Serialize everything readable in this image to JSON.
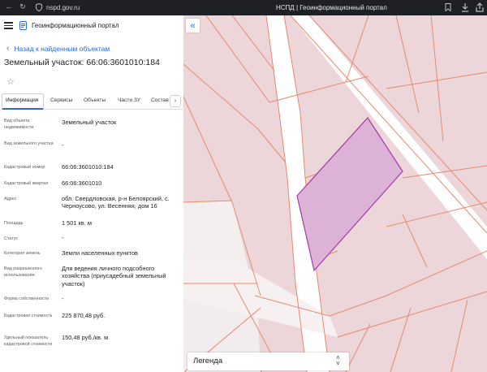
{
  "browser": {
    "url": "nspd.gov.ru",
    "tab_title": "НСПД | Геоинформационный портал"
  },
  "header": {
    "portal_title": "Геоинформационный портал"
  },
  "nav": {
    "back_label": "Назад к найденным объектам"
  },
  "parcel": {
    "title": "Земельный участок: 66:06:3601010:184"
  },
  "tabs": [
    {
      "label": "Информация",
      "active": true
    },
    {
      "label": "Сервисы"
    },
    {
      "label": "Объекты"
    },
    {
      "label": "Части ЗУ"
    },
    {
      "label": "Состав"
    }
  ],
  "attributes": [
    {
      "label": "Вид объекта недвижимости",
      "value": "Земельный участок"
    },
    {
      "label": "Вид земельного участка",
      "value": "-"
    },
    {
      "label": "Кадастровый номер",
      "value": "66:06:3601010:184"
    },
    {
      "label": "Кадастровый квартал",
      "value": "66:06:3601010"
    },
    {
      "label": "Адрес",
      "value": "обл. Свердловская, р-н Белоярский, с. Черноусово, ул. Весенняя, дом 16"
    },
    {
      "label": "Площадь",
      "value": "1 501 кв. м"
    },
    {
      "label": "Статус",
      "value": "-"
    },
    {
      "label": "Категория земель",
      "value": "Земли населенных пунктов"
    },
    {
      "label": "Вид разрешенного использования",
      "value": "Для ведения личного подсобного хозяйства (приусадебный земельный участок)"
    },
    {
      "label": "Форма собственности",
      "value": "-"
    },
    {
      "label": "Кадастровая стоимость",
      "value": "225 870,48 руб."
    },
    {
      "label": "Удельный показатель кадастровой стоимости",
      "value": "150,48 руб./кв. м"
    }
  ],
  "map": {
    "legend_label": "Легенда",
    "parcel_fill": "#dcb3d6",
    "parcel_stroke": "#a43aa6",
    "boundary_color": "#e58a6f",
    "background": "#ecd6da",
    "road_color": "#ffffff"
  },
  "icons": {
    "back": "arrow-left-icon",
    "reload": "reload-icon",
    "shield": "shield-icon",
    "menu": "hamburger-icon",
    "favorite": "star-icon",
    "collapse": "double-chevron-left-icon"
  }
}
